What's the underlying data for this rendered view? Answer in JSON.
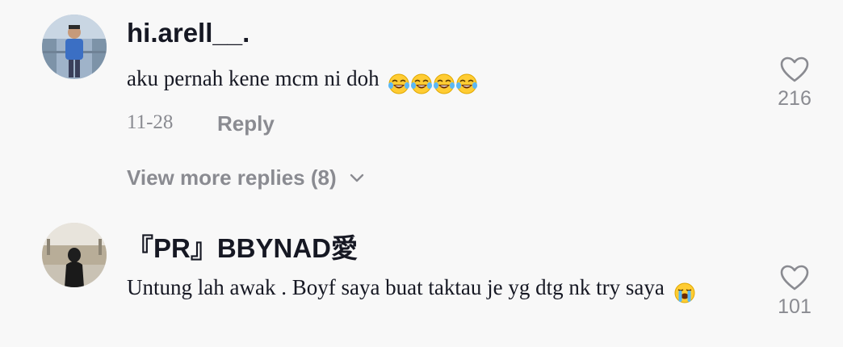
{
  "comments": [
    {
      "username": "hi.arell__.",
      "text": "aku pernah kene mcm ni doh",
      "emojis": [
        "tears-of-joy",
        "tears-of-joy",
        "tears-of-joy",
        "tears-of-joy"
      ],
      "date": "11-28",
      "reply_label": "Reply",
      "likes": "216"
    },
    {
      "username": "『PR』BBYNAD愛",
      "text": "Untung lah awak . Boyf saya buat taktau je yg dtg nk try saya",
      "emojis": [
        "loudly-crying"
      ],
      "likes": "101"
    }
  ],
  "view_more": {
    "label": "View more replies (8)"
  },
  "colors": {
    "background": "#f8f8f8",
    "primary_text": "#161823",
    "secondary_text": "#8a8b91"
  }
}
